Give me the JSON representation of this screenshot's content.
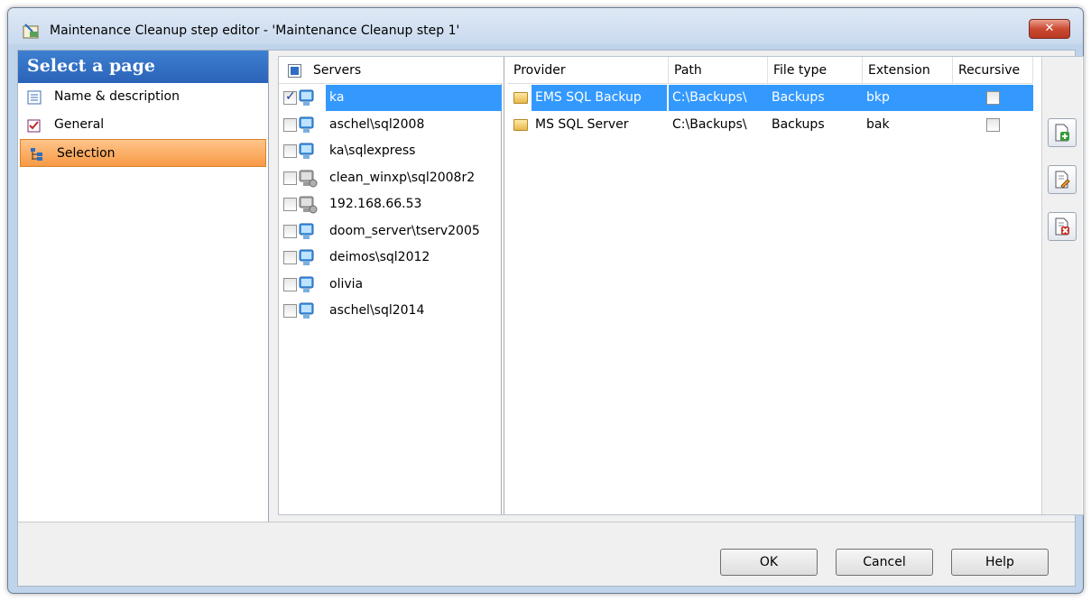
{
  "window": {
    "title": "Maintenance Cleanup step editor - 'Maintenance Cleanup step 1'",
    "close_label": "✕"
  },
  "nav": {
    "header": "Select a page",
    "items": [
      {
        "label": "Name & description",
        "icon": "list-icon",
        "active": false
      },
      {
        "label": "General",
        "icon": "checklist-icon",
        "active": false
      },
      {
        "label": "Selection",
        "icon": "tree-icon",
        "active": true
      }
    ]
  },
  "servers": {
    "header": "Servers",
    "rows": [
      {
        "name": "ka",
        "checked": true,
        "selected": true,
        "status": "online"
      },
      {
        "name": "aschel\\sql2008",
        "checked": false,
        "selected": false,
        "status": "online"
      },
      {
        "name": "ka\\sqlexpress",
        "checked": false,
        "selected": false,
        "status": "online"
      },
      {
        "name": "clean_winxp\\sql2008r2",
        "checked": false,
        "selected": false,
        "status": "offline"
      },
      {
        "name": "192.168.66.53",
        "checked": false,
        "selected": false,
        "status": "offline"
      },
      {
        "name": "doom_server\\tserv2005",
        "checked": false,
        "selected": false,
        "status": "online"
      },
      {
        "name": "deimos\\sql2012",
        "checked": false,
        "selected": false,
        "status": "online"
      },
      {
        "name": "olivia",
        "checked": false,
        "selected": false,
        "status": "online"
      },
      {
        "name": "aschel\\sql2014",
        "checked": false,
        "selected": false,
        "status": "online"
      }
    ]
  },
  "providers": {
    "columns": [
      "Provider",
      "Path",
      "File type",
      "Extension",
      "Recursive"
    ],
    "rows": [
      {
        "provider": "EMS SQL Backup",
        "path": "C:\\Backups\\",
        "file_type": "Backups",
        "extension": "bkp",
        "recursive": false,
        "selected": true
      },
      {
        "provider": "MS SQL Server",
        "path": "C:\\Backups\\",
        "file_type": "Backups",
        "extension": "bak",
        "recursive": false,
        "selected": false
      }
    ]
  },
  "side_buttons": [
    {
      "name": "add-provider-button",
      "icon": "add-doc-icon"
    },
    {
      "name": "edit-provider-button",
      "icon": "edit-doc-icon"
    },
    {
      "name": "delete-provider-button",
      "icon": "delete-doc-icon"
    }
  ],
  "footer": {
    "ok": "OK",
    "cancel": "Cancel",
    "help": "Help"
  },
  "colors": {
    "selection": "#3399ff",
    "nav_active": "#f79a45",
    "nav_header": "#2a63b8"
  }
}
